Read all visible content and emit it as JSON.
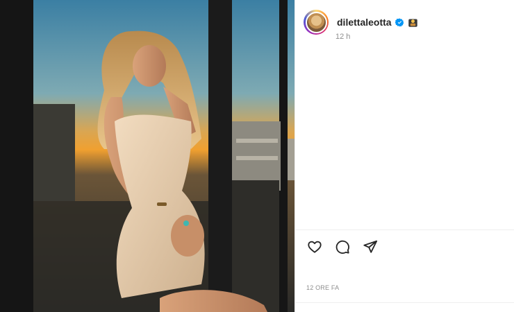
{
  "post": {
    "photo_alt": "Photo",
    "author": {
      "username": "dilettaleotta",
      "verified": true
    },
    "time_ago": "12 h",
    "date_label": "12 ORE FA",
    "actions": [
      "like-icon",
      "comment-icon",
      "share-icon"
    ]
  },
  "colors": {
    "text": "#262626",
    "secondary": "#8e8e8e",
    "verified": "#0095f6",
    "divider": "#efefef"
  }
}
